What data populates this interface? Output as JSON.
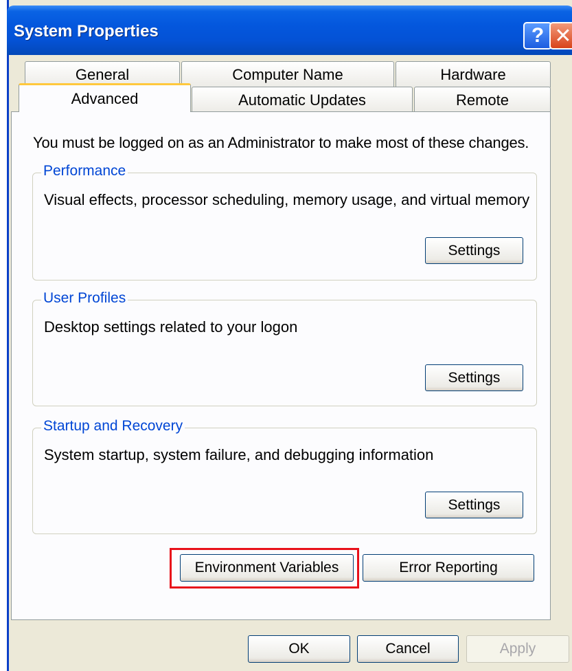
{
  "window": {
    "title": "System Properties",
    "help_glyph": "?",
    "close_glyph": "✕",
    "icons": {
      "help": "help-icon",
      "close": "close-icon"
    }
  },
  "tabs": {
    "row_back": [
      {
        "label": "General"
      },
      {
        "label": "Computer Name"
      },
      {
        "label": "Hardware"
      }
    ],
    "row_front": [
      {
        "label": "Advanced",
        "active": true
      },
      {
        "label": "Automatic Updates"
      },
      {
        "label": "Remote"
      }
    ]
  },
  "advanced": {
    "intro": "You must be logged on as an Administrator to make most of these changes.",
    "performance": {
      "legend": "Performance",
      "description": "Visual effects, processor scheduling, memory usage, and virtual memory",
      "button": "Settings"
    },
    "user_profiles": {
      "legend": "User Profiles",
      "description": "Desktop settings related to your logon",
      "button": "Settings"
    },
    "startup_recovery": {
      "legend": "Startup and Recovery",
      "description": "System startup, system failure, and debugging information",
      "button": "Settings"
    },
    "environment_variables": "Environment Variables",
    "error_reporting": "Error Reporting"
  },
  "footer": {
    "ok": "OK",
    "cancel": "Cancel",
    "apply": "Apply"
  },
  "colors": {
    "titlebar": "#0457dd",
    "window_bg": "#ece9d8",
    "legend_text": "#0046d5",
    "highlight": "#e8101a",
    "active_tab_accent": "#ffc83c"
  }
}
